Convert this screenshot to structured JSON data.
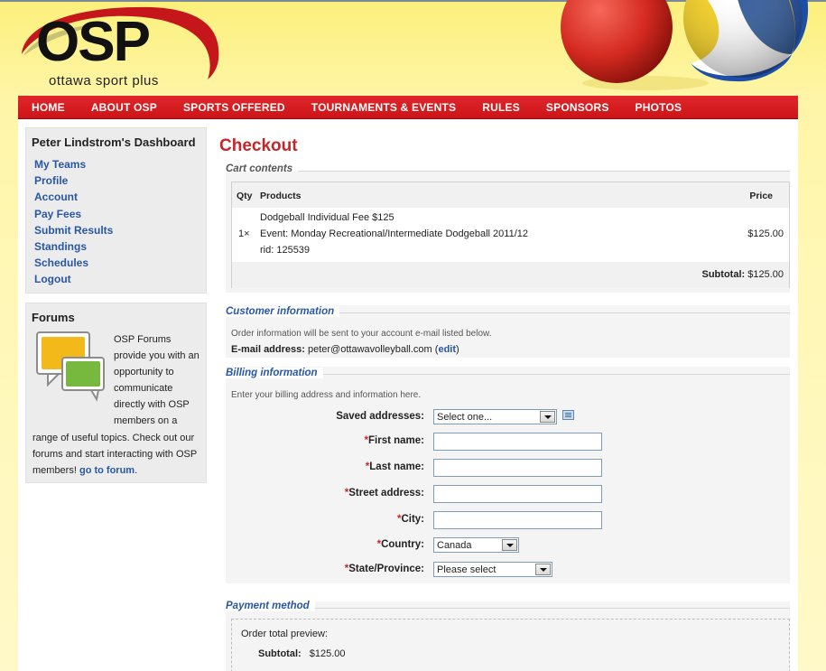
{
  "header": {
    "logo_text": "OSP",
    "logo_subtitle": "ottawa sport plus"
  },
  "nav": {
    "items": [
      "HOME",
      "ABOUT OSP",
      "SPORTS OFFERED",
      "TOURNAMENTS & EVENTS",
      "RULES",
      "SPONSORS",
      "PHOTOS"
    ]
  },
  "sidebar": {
    "dashboard_title": "Peter Lindstrom's Dashboard",
    "links": [
      "My Teams",
      "Profile",
      "Account",
      "Pay Fees",
      "Submit Results",
      "Standings",
      "Schedules",
      "Logout"
    ],
    "forums_title": "Forums",
    "forums_text": "OSP Forums provide you with an opportunity to communicate directly with OSP members on a range of useful topics. Check out our forums and start interacting with OSP members! ",
    "forums_link": "go to forum",
    "forums_end": "."
  },
  "main": {
    "title": "Checkout",
    "cart": {
      "legend": "Cart contents",
      "col_qty": "Qty",
      "col_products": "Products",
      "col_price": "Price",
      "item_line1": "Dodgeball Individual Fee $125",
      "item_line2": "Event: Monday Recreational/Intermediate Dodgeball 2011/12",
      "item_line3": "rid: 125539",
      "qty": "1×",
      "price": "$125.00",
      "subtotal_label": "Subtotal:",
      "subtotal_value": "$125.00"
    },
    "customer": {
      "legend": "Customer information",
      "note": "Order information will be sent to your account e-mail listed below.",
      "email_label": "E-mail address:",
      "email_value": "peter@ottawavolleyball.com",
      "edit_open": "(",
      "edit_link": "edit",
      "edit_close": ")"
    },
    "billing": {
      "legend": "Billing information",
      "note": "Enter your billing address and information here.",
      "saved_label": "Saved addresses:",
      "saved_value": "Select one...",
      "first_name_label": "First name:",
      "last_name_label": "Last name:",
      "street_label": "Street address:",
      "city_label": "City:",
      "country_label": "Country:",
      "country_value": "Canada",
      "state_label": "State/Province:",
      "state_value": "Please select",
      "required_mark": "*"
    },
    "payment": {
      "legend": "Payment method",
      "preview_label": "Order total preview:",
      "subtotal_label": "Subtotal:",
      "subtotal_value": "$125.00"
    }
  }
}
